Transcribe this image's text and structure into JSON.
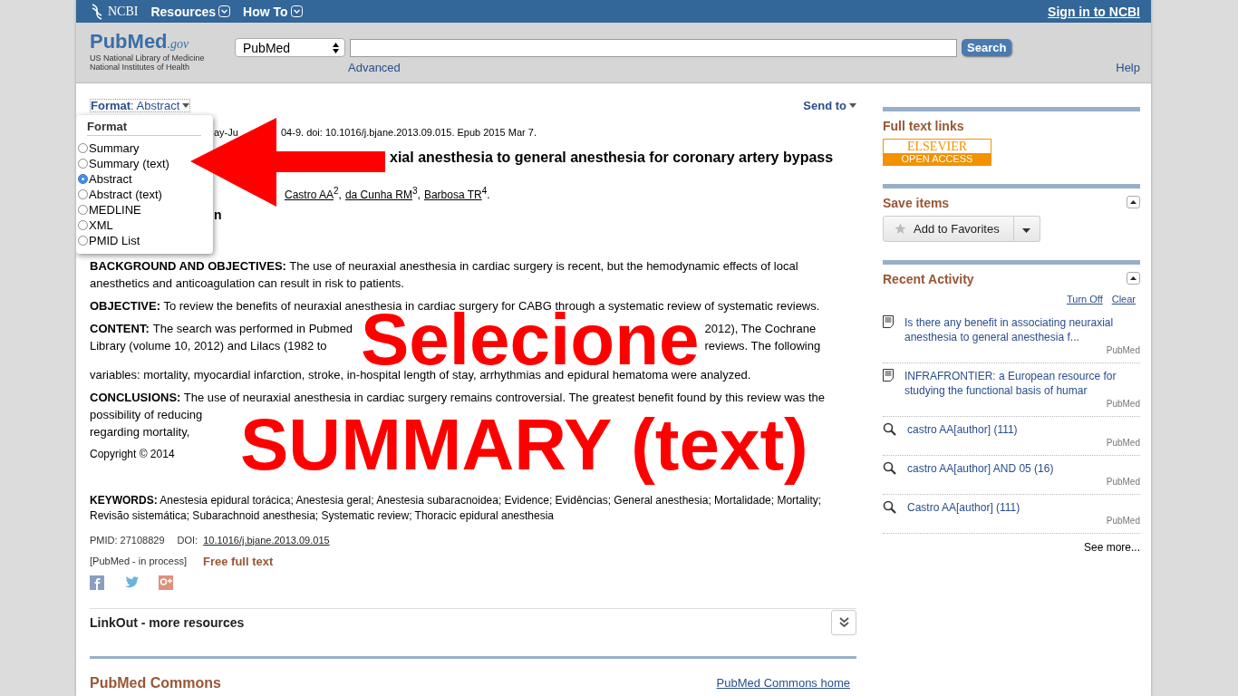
{
  "top_bar": {
    "brand": "NCBI",
    "menus": [
      "Resources",
      "How To"
    ],
    "sign_in": "Sign in to NCBI"
  },
  "header": {
    "logo": "PubMed",
    "logo_suffix": ".gov",
    "org_lines": [
      "US National Library of Medicine",
      "National Institutes of Health"
    ],
    "database": "PubMed",
    "search_button": "Search",
    "advanced": "Advanced",
    "help": "Help"
  },
  "toolbar": {
    "format": "**Format**: Abstract",
    "send_to": "Send to"
  },
  "format_menu": {
    "title": "Format",
    "options": [
      {
        "label": "Summary",
        "selected": false
      },
      {
        "label": "Summary (text)",
        "selected": false
      },
      {
        "label": "Abstract",
        "selected": true
      },
      {
        "label": "Abstract (text)",
        "selected": false
      },
      {
        "label": "MEDLINE",
        "selected": false
      },
      {
        "label": "XML",
        "selected": false
      },
      {
        "label": "PMID List",
        "selected": false
      }
    ]
  },
  "annotation_arrow": true,
  "article": {
    "citation_fragments": [
      "ay-Ju",
      "04-9. doi: 10.1016/j.bjane.2013.09.015. Epub 2015 Mar 7."
    ],
    "title_fragment": "xial anesthesia to general anesthesia for coronary artery bypass",
    "authors": [
      {
        "name": "Castro AA",
        "sup": "2",
        "after": ","
      },
      {
        "name": "da Cunha RM",
        "sup": "3",
        "after": ","
      },
      {
        "name": "Barbosa TR",
        "sup": "4",
        "after": "."
      }
    ],
    "affiliation_fragment": "n",
    "abstract": [
      {
        "kind": "plain",
        "heading": "BACKGROUND AND OBJECTIVES:",
        "text": "The use of neuraxial anesthesia in cardiac surgery is recent, but the hemodynamic effects of local anesthetics and anticoagulation can result in risk to patients."
      },
      {
        "kind": "plain",
        "heading": "OBJECTIVE:",
        "text": "To review the benefits of neuraxial anesthesia in cardiac surgery for CABG through a systematic review of systematic reviews."
      },
      {
        "kind": "overlay_top",
        "heading": "CONTENT:",
        "overlay": "Selecione",
        "rows": [
          {
            "left": "The search was performed in Pubmed",
            "right": "2012), The Cochrane"
          },
          {
            "left": "Library (volume 10, 2012) and Lilacs (1982 to",
            "right": "reviews. The following"
          }
        ],
        "text_after": "variables: mortality, myocardial infarction, stroke, in-hospital length of stay, arrhythmias and epidural hematoma were analyzed."
      },
      {
        "kind": "overlay_bottom",
        "heading": "CONCLUSIONS:",
        "text": "The use of neuraxial anesthesia in cardiac surgery remains controversial. The greatest benefit found by this review was the",
        "overlay": "SUMMARY (text)",
        "rows": [
          {
            "left": "possibility of reducing"
          },
          {
            "left": "regarding mortality,"
          }
        ],
        "copyright": "Copyright © 2014"
      }
    ],
    "keywords_label": "KEYWORDS:",
    "keywords": "Anestesia epidural torácica; Anestesia geral; Anestesia subaracnoidea; Evidence; Evidências; General anesthesia; Mortalidade; Mortality; Revisão sistemática; Subarachnoid anesthesia; Systematic review; Thoracic epidural anesthesia",
    "pmid": "PMID: 27108829",
    "doi_label": "DOI:",
    "doi": "10.1016/j.bjane.2013.09.015",
    "status": "[PubMed - in process]",
    "free_full_text": "Free full text"
  },
  "linkout": {
    "title": "LinkOut - more resources"
  },
  "commons": {
    "title": "PubMed Commons",
    "home_link": "PubMed Commons home"
  },
  "sidebar": {
    "full_text_title": "Full text links",
    "publisher": "ELSEVIER",
    "publisher_badge": "OPEN ACCESS",
    "save_title": "Save items",
    "favorites_button": "Add to Favorites",
    "recent_title": "Recent Activity",
    "turn_off": "Turn Off",
    "clear": "Clear",
    "recent_items": [
      {
        "kind": "document",
        "text": "Is there any benefit in associating neuraxial anesthesia to general anesthesia f...",
        "source": "PubMed"
      },
      {
        "kind": "document",
        "text": "INFRAFRONTIER: a European resource for studying the functional basis of humar",
        "source": "PubMed"
      },
      {
        "kind": "search",
        "text": "castro AA[author] (111)",
        "source": "PubMed"
      },
      {
        "kind": "search",
        "text": "castro AA[author] AND 05 (16)",
        "source": "PubMed"
      },
      {
        "kind": "search",
        "text": "Castro AA[author] (111)",
        "source": "PubMed"
      }
    ],
    "see_more": "See more..."
  }
}
